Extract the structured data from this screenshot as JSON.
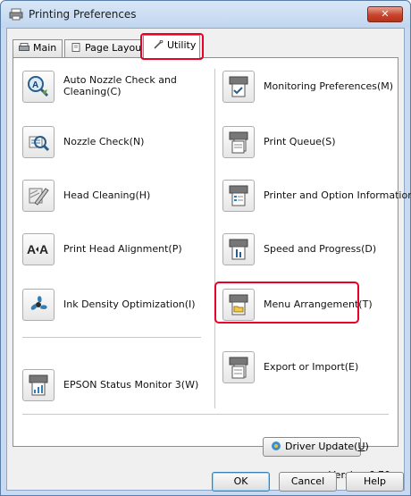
{
  "window": {
    "title": "Printing Preferences",
    "close_symbol": "✕"
  },
  "tabs": [
    {
      "label": "Main",
      "icon": "printer-icon"
    },
    {
      "label": "Page Layout",
      "icon": "page-icon"
    },
    {
      "label": "Utility",
      "icon": "wrench-icon",
      "active": true
    }
  ],
  "left_items": [
    {
      "label": "Auto Nozzle Check and Cleaning(C)",
      "icon": "auto-nozzle-check-icon"
    },
    {
      "label": "Nozzle Check(N)",
      "icon": "nozzle-check-icon"
    },
    {
      "label": "Head Cleaning(H)",
      "icon": "head-cleaning-icon"
    },
    {
      "label": "Print Head Alignment(P)",
      "icon": "print-head-alignment-icon"
    },
    {
      "label": "Ink Density Optimization(I)",
      "icon": "ink-density-icon"
    },
    {
      "label": "EPSON Status Monitor 3(W)",
      "icon": "status-monitor-icon"
    }
  ],
  "right_items": [
    {
      "label": "Monitoring Preferences(M)",
      "icon": "monitoring-preferences-icon"
    },
    {
      "label": "Print Queue(S)",
      "icon": "print-queue-icon"
    },
    {
      "label": "Printer and Option Information(O)",
      "icon": "printer-information-icon"
    },
    {
      "label": "Speed and Progress(D)",
      "icon": "speed-progress-icon"
    },
    {
      "label": "Menu Arrangement(T)",
      "icon": "menu-arrangement-icon",
      "highlighted": true
    },
    {
      "label": "Export or Import(E)",
      "icon": "export-import-icon"
    }
  ],
  "driver_update": {
    "label": "Driver Update(",
    "mnemonic": "U",
    "suffix": ")"
  },
  "version": {
    "label": "Version",
    "value": "6.70"
  },
  "buttons": {
    "ok": "OK",
    "cancel": "Cancel",
    "help": "Help"
  },
  "colors": {
    "highlight": "#e8002a",
    "titlebar": "#c9daf0"
  }
}
